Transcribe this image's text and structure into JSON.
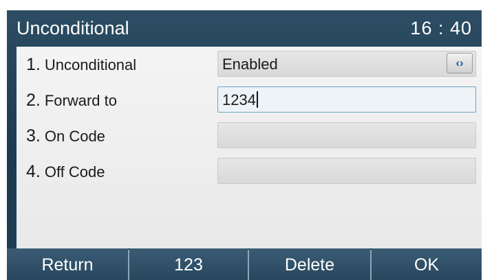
{
  "header": {
    "title": "Unconditional",
    "time": "16 : 40"
  },
  "rows": [
    {
      "num": "1.",
      "label": "Unconditional",
      "value": "Enabled",
      "toggle_icon": "switch-arrows-icon"
    },
    {
      "num": "2.",
      "label": "Forward to",
      "value": "1234"
    },
    {
      "num": "3.",
      "label": "On Code",
      "value": ""
    },
    {
      "num": "4.",
      "label": "Off Code",
      "value": ""
    }
  ],
  "softkeys": [
    {
      "label": "Return"
    },
    {
      "label": "123"
    },
    {
      "label": "Delete"
    },
    {
      "label": "OK"
    }
  ],
  "colors": {
    "title_bar": "#2c4d63",
    "panel": "#f0f0f0",
    "active_border": "#6aa4c8",
    "toggle_arrow": "#1d5fa0"
  }
}
